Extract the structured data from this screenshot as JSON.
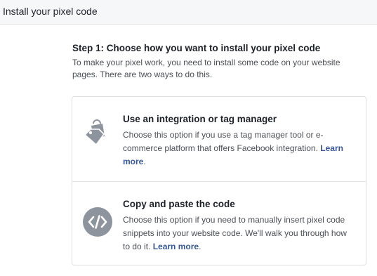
{
  "header": {
    "title": "Install your pixel code"
  },
  "step": {
    "title": "Step 1: Choose how you want to install your pixel code",
    "description": "To make your pixel work, you need to install some code on your website pages. There are two ways to do this."
  },
  "options": [
    {
      "title": "Use an integration or tag manager",
      "description": "Choose this option if you use a tag manager tool or e-commerce platform that offers Facebook integration.",
      "link": "Learn more",
      "suffix": ".",
      "icon": "tags-shopping-bag-icon"
    },
    {
      "title": "Copy and paste the code",
      "description": "Choose this option if you need to manually insert pixel code snippets into your website code. We'll walk you through how to do it.",
      "link": "Learn more",
      "suffix": ".",
      "icon": "code-brackets-icon"
    }
  ],
  "colors": {
    "icon": "#8d949e",
    "link": "#365899",
    "text": "#1d2129",
    "muted": "#4b4f56"
  }
}
